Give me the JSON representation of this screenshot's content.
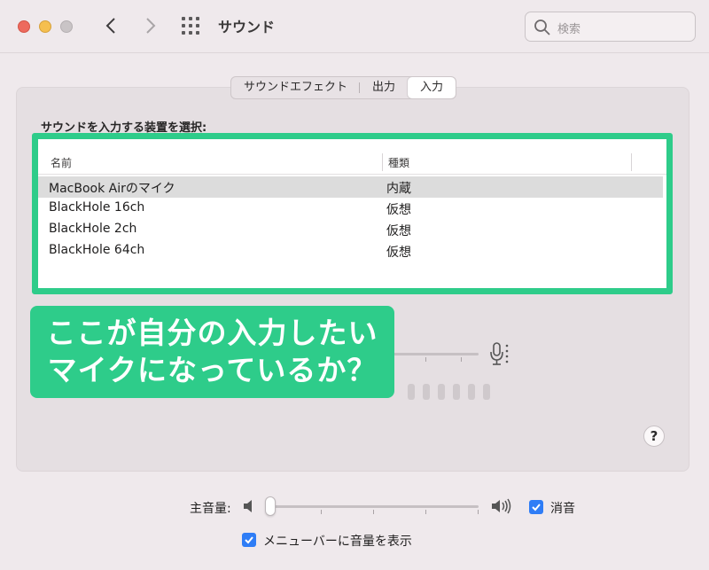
{
  "window": {
    "title": "サウンド",
    "search_placeholder": "検索"
  },
  "tabs": [
    {
      "label": "サウンドエフェクト",
      "active": false
    },
    {
      "label": "出力",
      "active": false
    },
    {
      "label": "入力",
      "active": true
    }
  ],
  "input": {
    "select_label": "サウンドを入力する装置を選択:",
    "columns": [
      "名前",
      "種類"
    ],
    "devices": [
      {
        "name": "MacBook Airのマイク",
        "type": "内蔵",
        "selected": true
      },
      {
        "name": "BlackHole 16ch",
        "type": "仮想",
        "selected": false
      },
      {
        "name": "BlackHole 2ch",
        "type": "仮想",
        "selected": false
      },
      {
        "name": "BlackHole 64ch",
        "type": "仮想",
        "selected": false
      }
    ]
  },
  "callout": {
    "line1": "ここが自分の入力したい",
    "line2": "マイクになっているか？",
    "color": "#2ecc8a"
  },
  "help": {
    "label": "?"
  },
  "output_volume": {
    "label": "主音量:",
    "level": 0.0,
    "mute_label": "消音",
    "mute_checked": true
  },
  "menubar_option": {
    "label": "メニューバーに音量を表示",
    "checked": true
  },
  "colors": {
    "accent_green": "#2ecc8a",
    "checkbox_blue": "#2f7df6"
  }
}
